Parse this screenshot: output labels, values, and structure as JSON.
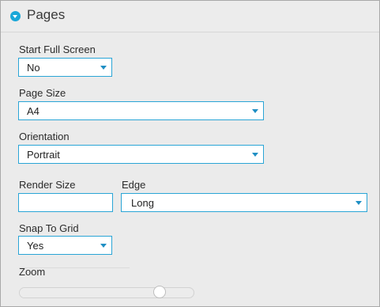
{
  "header": {
    "title": "Pages",
    "icon": "chevron-down-circle-icon"
  },
  "fields": {
    "start_full_screen": {
      "label": "Start Full Screen",
      "value": "No"
    },
    "page_size": {
      "label": "Page Size",
      "value": "A4"
    },
    "orientation": {
      "label": "Orientation",
      "value": "Portrait"
    },
    "render_size": {
      "label": "Render Size",
      "value": ""
    },
    "edge": {
      "label": "Edge",
      "value": "Long"
    },
    "snap_to_grid": {
      "label": "Snap To Grid",
      "value": "Yes"
    },
    "zoom": {
      "label": "Zoom",
      "level_fraction": 0.83
    }
  },
  "colors": {
    "accent": "#2aa5d6",
    "icon": "#1aa7d8"
  }
}
